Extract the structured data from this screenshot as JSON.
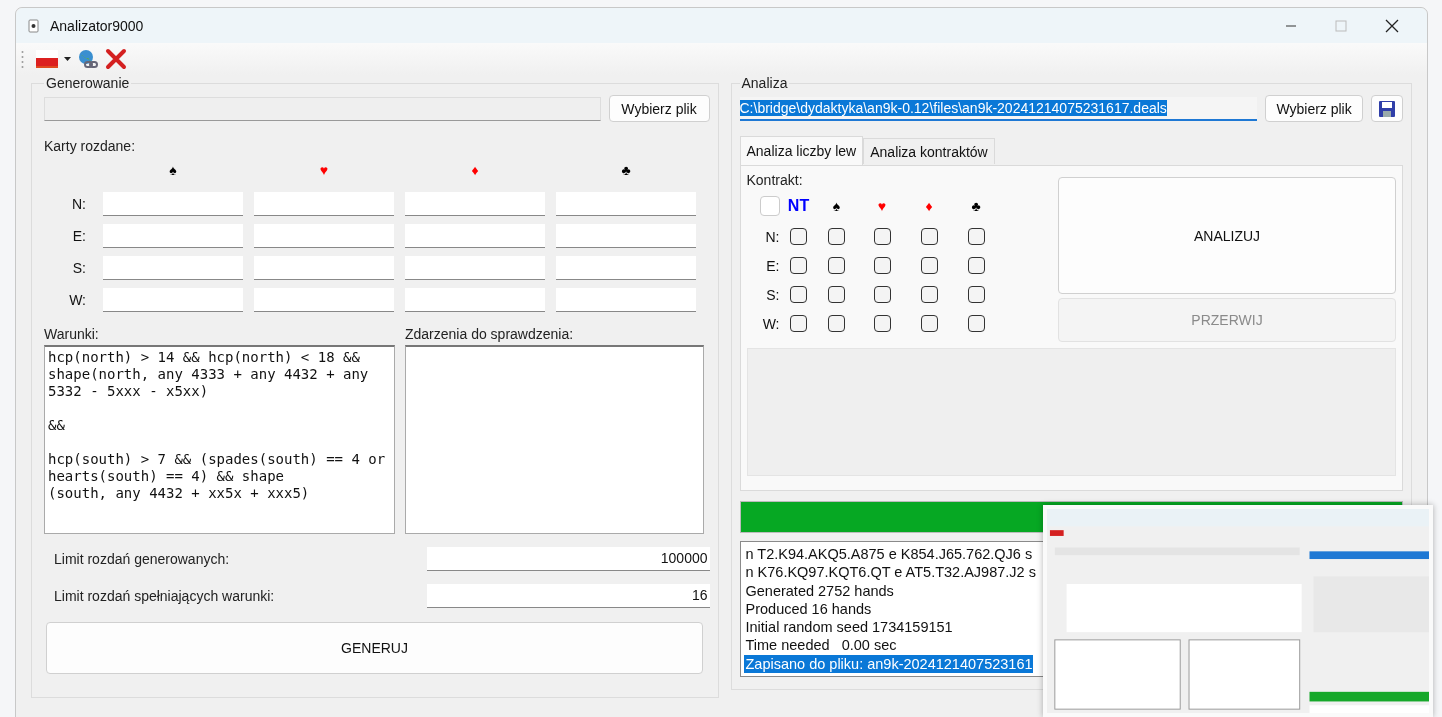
{
  "window": {
    "title": "Analizator9000"
  },
  "generowanie": {
    "title": "Generowanie",
    "file_button": "Wybierz plik",
    "cards_label": "Karty rozdane:",
    "suits": [
      {
        "symbol": "♠",
        "color": "#000000"
      },
      {
        "symbol": "♥",
        "color": "#ff0000"
      },
      {
        "symbol": "♦",
        "color": "#ff0000"
      },
      {
        "symbol": "♣",
        "color": "#000000"
      }
    ],
    "hands": [
      {
        "label": "N:"
      },
      {
        "label": "E:"
      },
      {
        "label": "S:"
      },
      {
        "label": "W:"
      }
    ],
    "conditions_label": "Warunki:",
    "conditions": "hcp(north) > 14 && hcp(north) < 18 && shape(north, any 4333 + any 4432 + any 5332 - 5xxx - x5xx)\n\n&&\n\nhcp(south) > 7 && (spades(south) == 4 or hearts(south) == 4) && shape\n(south, any 4432 + xx5x + xxx5)",
    "events_label": "Zdarzenia do sprawdzenia:",
    "limits": [
      {
        "label": "Limit rozdań generowanych:",
        "value": "100000"
      },
      {
        "label": "Limit rozdań spełniających warunki:",
        "value": "16"
      }
    ],
    "generate_button": "GENERUJ"
  },
  "analiza": {
    "title": "Analiza",
    "path": {
      "value": "C:\\bridge\\dydaktyka\\an9k-0.12\\files\\an9k-20241214075231617.deals",
      "highlighted": true
    },
    "file_button": "Wybierz plik",
    "tabs": [
      {
        "label": "Analiza liczby lew",
        "selected": true
      },
      {
        "label": "Analiza kontraktów",
        "selected": false
      }
    ],
    "contract_label": "Kontrakt:",
    "select_all": {
      "checked": false
    },
    "strains": [
      {
        "symbol": "NT",
        "color": "#0000ff"
      },
      {
        "symbol": "♠",
        "color": "#000000"
      },
      {
        "symbol": "♥",
        "color": "#ff0000"
      },
      {
        "symbol": "♦",
        "color": "#ff0000"
      },
      {
        "symbol": "♣",
        "color": "#000000"
      }
    ],
    "rows": [
      {
        "label": "N:",
        "checks": [
          false,
          false,
          false,
          false,
          false
        ]
      },
      {
        "label": "E:",
        "checks": [
          false,
          false,
          false,
          false,
          false
        ]
      },
      {
        "label": "S:",
        "checks": [
          false,
          false,
          false,
          false,
          false
        ]
      },
      {
        "label": "W:",
        "checks": [
          false,
          false,
          false,
          false,
          false
        ]
      }
    ],
    "analyze_button": "ANALIZUJ",
    "stop_button": {
      "label": "PRZERWIJ",
      "disabled": true
    },
    "progress": {
      "level": 1
    },
    "log": [
      {
        "text": "n T2.K94.AKQ5.A875 e K854.J65.762.QJ6 s",
        "selected": false
      },
      {
        "text": "n K76.KQ97.KQT6.QT e AT5.T32.AJ987.J2 s",
        "selected": false
      },
      {
        "text": "Generated 2752 hands",
        "selected": false
      },
      {
        "text": "Produced 16 hands",
        "selected": false
      },
      {
        "text": "Initial random seed 1734159151",
        "selected": false
      },
      {
        "text": "Time needed   0.00 sec",
        "selected": false
      },
      {
        "text": "Zapisano do pliku: an9k-2024121407523161",
        "selected": true
      }
    ]
  }
}
